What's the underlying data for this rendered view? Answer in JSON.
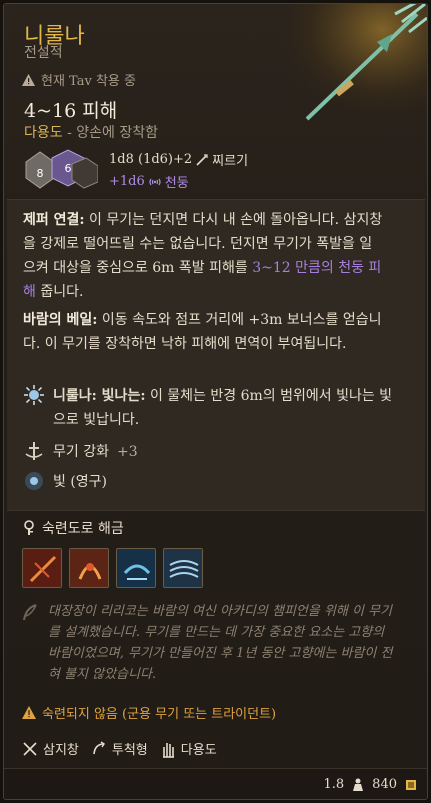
{
  "item": {
    "name": "니룰나",
    "rarity": "전설적",
    "equipped_text": "현재 Tav 착용 중",
    "damage": "4~16 피해",
    "weapon_type_primary": "다용도",
    "weapon_type_secondary": "- 양손에 장착함",
    "dice_values": [
      "8",
      "6"
    ],
    "damage_roll": "1d8 (1d6)+2",
    "damage_type": "찌르기",
    "bonus_roll": "+1d6",
    "bonus_type": "천둥"
  },
  "descriptions": {
    "p1_title": "제퍼 연결:",
    "p1_text1": " 이 무기는 던지면 다시 내 손에 돌아옵니다. 삼지창을 강제로 떨어뜨릴 수는 없습니다. 던지면 무기가 폭발을 일으켜 대상을 중심으로 6m 폭발 피해를 ",
    "p1_purple": "3~12 만큼의 천둥 피해",
    "p1_text2": " 줍니다.",
    "p2_title": "바람의 베일:",
    "p2_text": " 이동 속도와 점프 거리에 +3m 보너스를 얻습니다. 이 무기를 장착하면 낙하 피해에 면역이 부여됩니다.",
    "p3_title": "니룰나: 빛나는:",
    "p3_text": " 이 물체는 반경 6m의 범위에서 빛나는 빛으로 빛납니다.",
    "enchant_label": "무기 강화",
    "enchant_value": "+3",
    "light_label": "빛 (영구)"
  },
  "proficiency": {
    "unlock_label": "숙련도로 해금",
    "skills": [
      "skill-1",
      "skill-2",
      "skill-3",
      "skill-4"
    ]
  },
  "flavor_text": "대장장이 리리코는 바람의 여신 아카디의 챔피언을 위해 이 무기를 설계했습니다. 무기를 만드는 데 가장 중요한 요소는 고향의 바람이었으며, 무기가 만들어진 후 1년 동안 고향에는 바람이 전혀 불지 않았습니다.",
  "warning_text": "숙련되지 않음 (군용 무기 또는 트라이던트)",
  "properties": [
    {
      "label": "삼지창",
      "icon": "trident-icon"
    },
    {
      "label": "투척형",
      "icon": "throw-icon"
    },
    {
      "label": "다용도",
      "icon": "hand-icon"
    }
  ],
  "footer": {
    "weight": "1.8",
    "price": "840"
  },
  "colors": {
    "legendary": "#e3b64a",
    "thunder": "#a67fe0",
    "warning": "#e0a240"
  }
}
